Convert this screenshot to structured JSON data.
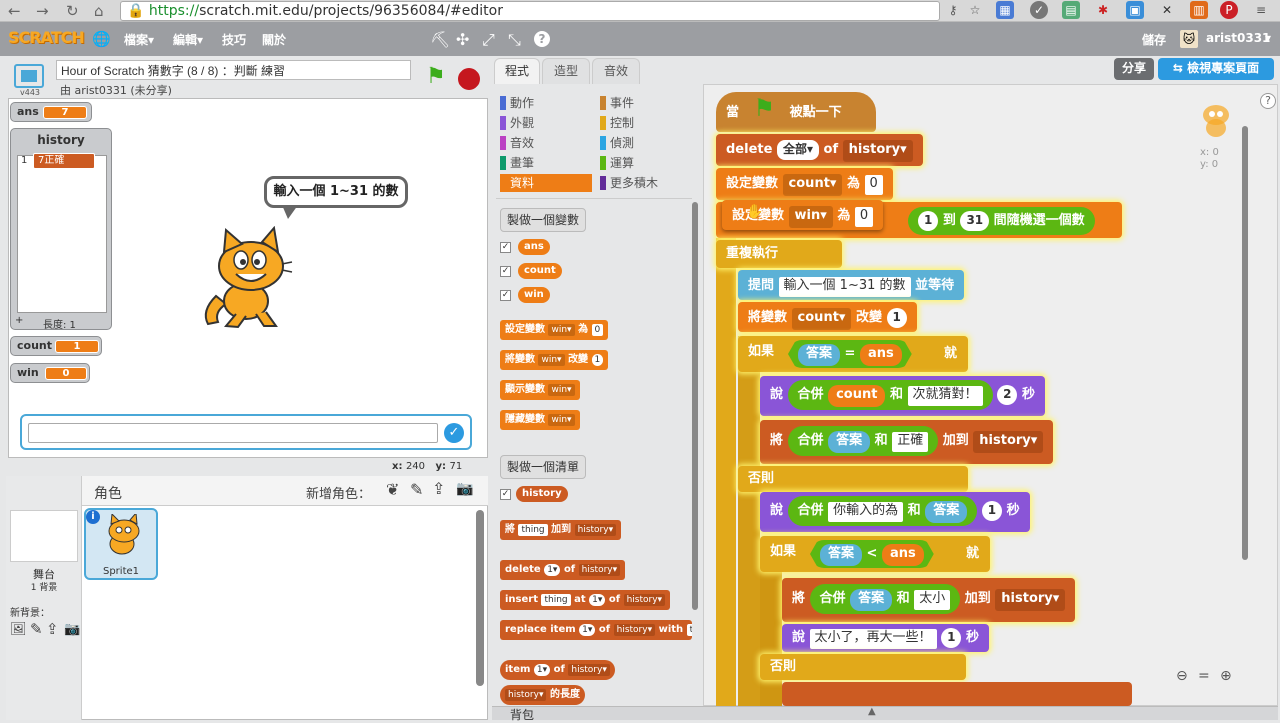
{
  "browser": {
    "url_scheme": "https://",
    "url_rest": "scratch.mit.edu/projects/96356084/#editor"
  },
  "menubar": {
    "logo": "SCRATCH",
    "file": "檔案▾",
    "edit": "編輯▾",
    "tips": "技巧",
    "about": "關於",
    "save": "儲存",
    "username": "arist0331",
    "username_suffix": "▾"
  },
  "project": {
    "title": "Hour of Scratch 猜數字 (8 / 8) ：判斷 練習",
    "author": "由 arist0331 (未分享)",
    "version": "v443"
  },
  "monitors": {
    "ans": {
      "label": "ans",
      "value": "7"
    },
    "history": {
      "label": "history",
      "items": [
        "7正確"
      ],
      "index": "1",
      "length": "長度: 1"
    },
    "count": {
      "label": "count",
      "value": "1"
    },
    "win": {
      "label": "win",
      "value": "0"
    }
  },
  "stage": {
    "speech": "輸入一個 1~31 的數",
    "coords_x_label": "x:",
    "coords_x": "240",
    "coords_y_label": "y:",
    "coords_y": "71"
  },
  "sprites": {
    "header": "角色",
    "new_sprite": "新增角色：",
    "stage_label": "舞台",
    "stage_sub": "1 背景",
    "new_backdrop": "新背景：",
    "sprite1": "Sprite1"
  },
  "tabs": {
    "scripts": "程式",
    "costumes": "造型",
    "sounds": "音效"
  },
  "categories": [
    {
      "label": "動作",
      "color": "#4a6cd4"
    },
    {
      "label": "外觀",
      "color": "#8a55d7"
    },
    {
      "label": "音效",
      "color": "#bb42c3"
    },
    {
      "label": "畫筆",
      "color": "#0e9a6c"
    },
    {
      "label": "資料",
      "color": "#ee7d16"
    },
    {
      "label": "事件",
      "color": "#c88330"
    },
    {
      "label": "控制",
      "color": "#e1a91a"
    },
    {
      "label": "偵測",
      "color": "#2ca5e2"
    },
    {
      "label": "運算",
      "color": "#5cb712"
    },
    {
      "label": "更多積木",
      "color": "#632d99"
    }
  ],
  "palette": {
    "make_var": "製做一個變數",
    "vars": [
      "ans",
      "count",
      "win"
    ],
    "set_var": {
      "a": "設定變數",
      "var": "win▾",
      "b": "為",
      "val": "0"
    },
    "change_var": {
      "a": "將變數",
      "var": "win▾",
      "b": "改變",
      "val": "1"
    },
    "show_var": {
      "a": "顯示變數",
      "var": "win▾"
    },
    "hide_var": {
      "a": "隱藏變數",
      "var": "win▾"
    },
    "make_list": "製做一個清單",
    "list": "history",
    "add": {
      "a": "將",
      "thing": "thing",
      "b": "加到",
      "list": "history▾"
    },
    "delete": {
      "a": "delete",
      "n": "1▾",
      "b": "of",
      "list": "history▾"
    },
    "insert": {
      "a": "insert",
      "thing": "thing",
      "b": "at",
      "n": "1▾",
      "c": "of",
      "list": "history▾"
    },
    "replace": {
      "a": "replace",
      "b": "item",
      "n": "1▾",
      "c": "of",
      "list": "history▾",
      "d": "with",
      "e": "t"
    },
    "item": {
      "a": "item",
      "n": "1▾",
      "b": "of",
      "list": "history▾"
    },
    "length": {
      "list": "history▾",
      "b": "的長度"
    }
  },
  "script": {
    "hat": {
      "a": "當",
      "b": "被點一下"
    },
    "delete": {
      "a": "delete",
      "opt": "全部▾",
      "b": "of",
      "list": "history▾"
    },
    "set_count": {
      "a": "設定變數",
      "var": "count▾",
      "b": "為",
      "val": "0"
    },
    "set_win": {
      "a": "設定變數",
      "var": "win▾",
      "b": "為",
      "val": "0"
    },
    "random": {
      "from": "1",
      "b": "到",
      "to": "31",
      "c": "間隨機選一個數"
    },
    "forever": "重複執行",
    "ask": {
      "a": "提問",
      "q": "輸入一個 1~31 的數",
      "b": "並等待"
    },
    "change": {
      "a": "將變數",
      "var": "count▾",
      "b": "改變",
      "val": "1"
    },
    "if1": {
      "a": "如果",
      "ans": "答案",
      "op": "=",
      "var": "ans",
      "b": "就"
    },
    "say1": {
      "a": "說",
      "join": "合併",
      "var": "count",
      "b": "和",
      "txt": "次就猜對！",
      "secs": "2",
      "c": "秒"
    },
    "add1": {
      "a": "將",
      "join": "合併",
      "ans": "答案",
      "b": "和",
      "txt": "正確",
      "c": "加到",
      "list": "history▾"
    },
    "else1": "否則",
    "say2": {
      "a": "說",
      "join": "合併",
      "txt": "你輸入的為",
      "b": "和",
      "ans": "答案",
      "secs": "1",
      "c": "秒"
    },
    "if2": {
      "a": "如果",
      "ans": "答案",
      "op": "<",
      "var": "ans",
      "b": "就"
    },
    "add2": {
      "a": "將",
      "join": "合併",
      "ans": "答案",
      "b": "和",
      "txt": "太小",
      "c": "加到",
      "list": "history▾"
    },
    "say3": {
      "a": "說",
      "txt": "太小了，再大一些！",
      "secs": "1",
      "c": "秒"
    },
    "else2": "否則",
    "sprite_x": "x: 0",
    "sprite_y": "y: 0"
  },
  "buttons": {
    "share": "分享",
    "see_page": "檢視專案頁面"
  },
  "backpack": "背包"
}
